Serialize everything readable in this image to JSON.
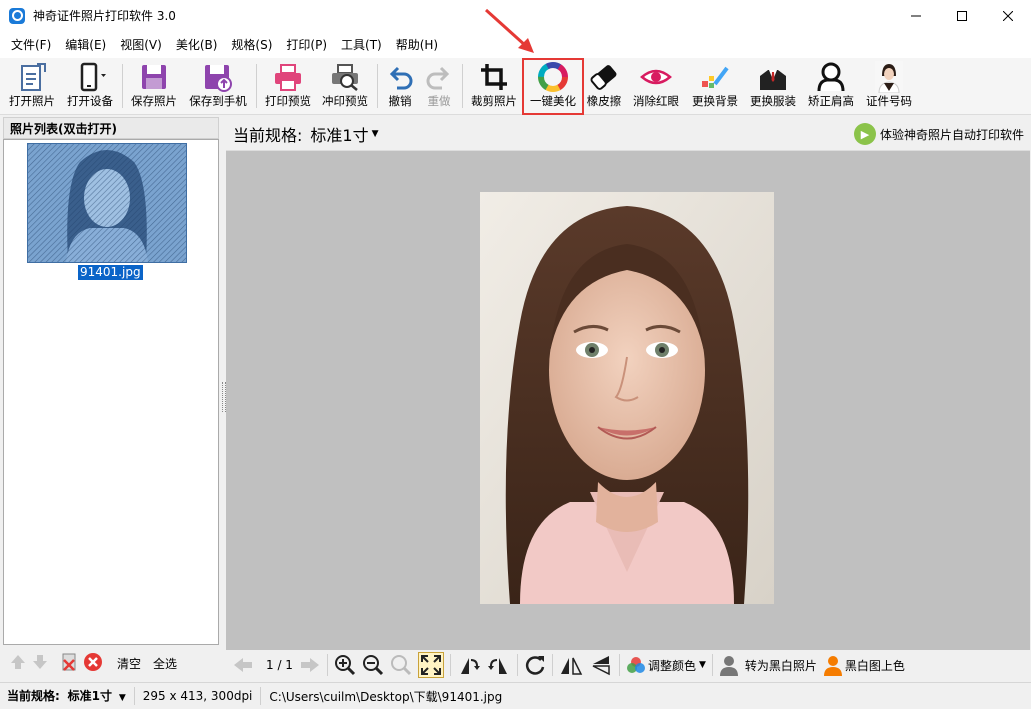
{
  "window": {
    "title": "神奇证件照片打印软件 3.0",
    "controls": {
      "minimize": "─",
      "maximize": "☐",
      "close": "✕"
    }
  },
  "menu": [
    "文件(F)",
    "编辑(E)",
    "视图(V)",
    "美化(B)",
    "规格(S)",
    "打印(P)",
    "工具(T)",
    "帮助(H)"
  ],
  "toolbar": {
    "open_photo": "打开照片",
    "open_device": "打开设备",
    "save_photo": "保存照片",
    "save_to_phone": "保存到手机",
    "print_preview": "打印预览",
    "develop_preview": "冲印预览",
    "undo": "撤销",
    "redo": "重做",
    "crop": "裁剪照片",
    "one_click_beautify": "一键美化",
    "eraser": "橡皮擦",
    "red_eye": "消除红眼",
    "change_background": "更换背景",
    "change_clothes": "更换服装",
    "fix_shoulder": "矫正肩高",
    "id_number": "证件号码"
  },
  "left_panel": {
    "title": "照片列表(双击打开)",
    "file_name": "91401.jpg",
    "clear": "清空",
    "select_all": "全选"
  },
  "main": {
    "spec_label": "当前规格:",
    "spec_value": "标准1寸",
    "promo": "体验神奇照片自动打印软件"
  },
  "viewer": {
    "page": "1 / 1",
    "adjust_color": "调整颜色",
    "to_bw": "转为黑白照片",
    "bw_colorize": "黑白图上色"
  },
  "status": {
    "spec_label": "当前规格:",
    "spec_value": "标准1寸",
    "dimensions": "295 x 413, 300dpi",
    "path": "C:\\Users\\cuilm\\Desktop\\下载\\91401.jpg"
  },
  "colors": {
    "highlight": "#e53935",
    "selection": "#0a64c8",
    "canvas": "#c0c0c0"
  }
}
